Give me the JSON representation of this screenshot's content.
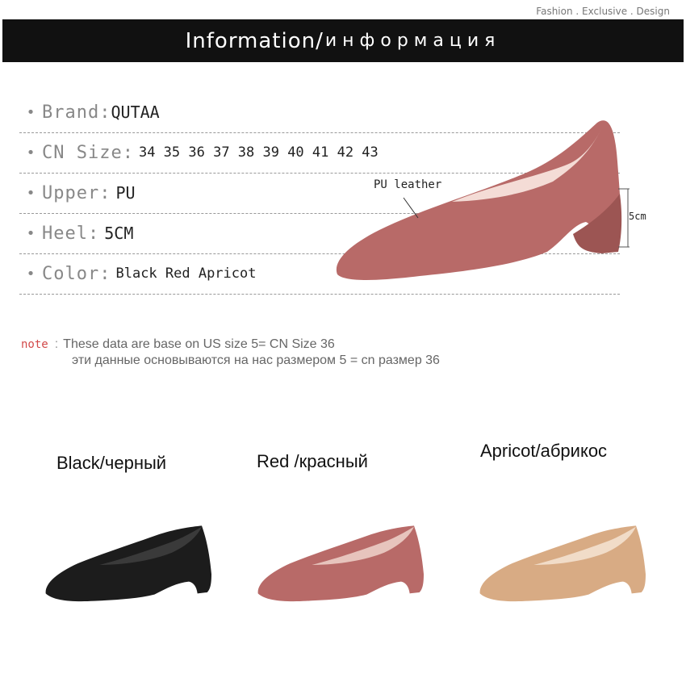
{
  "tagline": "Fashion  . Exclusive  . Design",
  "banner": {
    "title_en": "Information/",
    "title_ru": "информация"
  },
  "specs": [
    {
      "bullet": "•",
      "label": "Brand:",
      "value": "QUTAA"
    },
    {
      "bullet": "•",
      "label": "CN Size:",
      "value": "34 35 36 37 38 39 40 41 42 43"
    },
    {
      "bullet": "•",
      "label": "Upper: ",
      "value": "PU"
    },
    {
      "bullet": "•",
      "label": "Heel: ",
      "value": "5CM"
    },
    {
      "bullet": "•",
      "label": "Color:",
      "value": "Black Red Apricot"
    }
  ],
  "hero": {
    "material_label": "PU leather",
    "heel_height_label": "5cm",
    "color": "#b86a68"
  },
  "note": {
    "keyword": "note",
    "colon": ":",
    "line1": "These data are base on US size 5= CN Size 36",
    "line2": "эти данные основываются на нас размером 5 = cn размер 36"
  },
  "colors": [
    {
      "label": "Black/черный",
      "hex": "#1c1c1c"
    },
    {
      "label": "Red /красный",
      "hex": "#b86a68"
    },
    {
      "label": "Apricot/абрикос",
      "hex": "#d8ab84"
    }
  ]
}
